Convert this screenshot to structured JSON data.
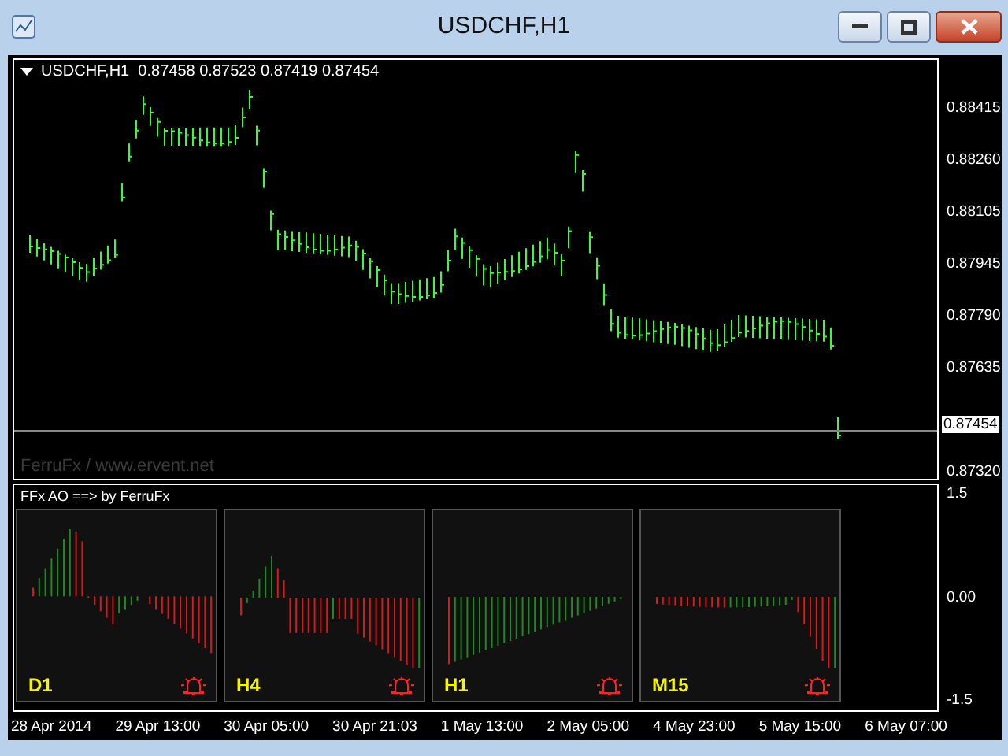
{
  "window": {
    "title": "USDCHF,H1"
  },
  "chart": {
    "header": "USDCHF,H1  0.87458 0.87523 0.87419 0.87454",
    "watermark": "FerruFx / www.ervent.net",
    "price_labels": [
      "0.88415",
      "0.88260",
      "0.88105",
      "0.87945",
      "0.87790",
      "0.87635",
      "0.87320"
    ],
    "current_price": "0.87454"
  },
  "indicator": {
    "title": "FFx AO ==> by FerruFx",
    "scale_labels": [
      "1.5",
      "0.00",
      "-1.5"
    ],
    "panels": [
      {
        "label": "D1"
      },
      {
        "label": "H4"
      },
      {
        "label": "H1"
      },
      {
        "label": "M15"
      }
    ]
  },
  "time_axis": [
    "28 Apr 2014",
    "29 Apr 13:00",
    "30 Apr 05:00",
    "30 Apr 21:03",
    "1 May 13:00",
    "2 May 05:00",
    "4 May 23:00",
    "5 May 15:00",
    "6 May 07:00"
  ]
}
